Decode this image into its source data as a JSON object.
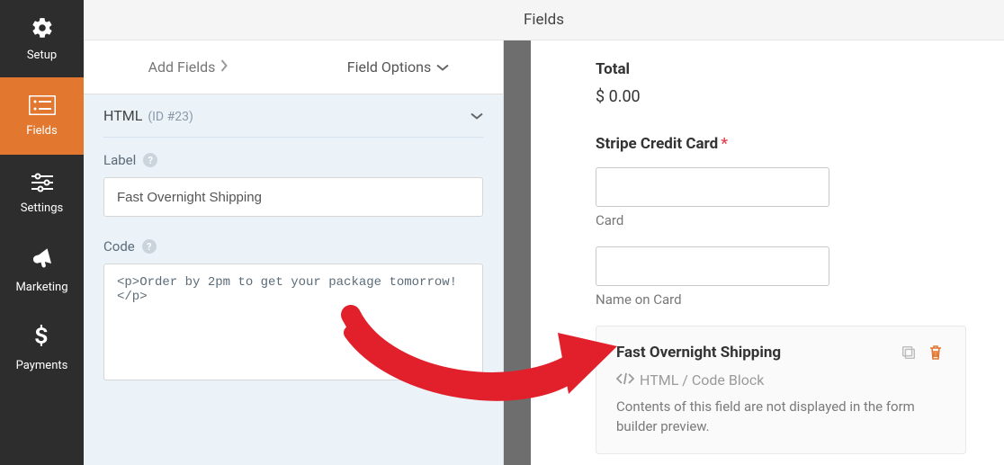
{
  "sidebar": {
    "items": [
      {
        "label": "Setup"
      },
      {
        "label": "Fields"
      },
      {
        "label": "Settings"
      },
      {
        "label": "Marketing"
      },
      {
        "label": "Payments"
      }
    ]
  },
  "header": {
    "title": "Fields"
  },
  "tabs": {
    "add_fields": "Add Fields",
    "field_options": "Field Options"
  },
  "field_panel": {
    "type": "HTML",
    "id_label": "(ID #23)",
    "label_heading": "Label",
    "label_value": "Fast Overnight Shipping",
    "code_heading": "Code",
    "code_value": "<p>Order by 2pm to get your package tomorrow!</p>"
  },
  "preview": {
    "total_label": "Total",
    "total_value": "$ 0.00",
    "stripe_label": "Stripe Credit Card",
    "card_sub": "Card",
    "name_sub": "Name on Card",
    "html_block": {
      "title": "Fast Overnight Shipping",
      "sub": "HTML / Code Block",
      "desc": "Contents of this field are not displayed in the form builder preview."
    }
  }
}
